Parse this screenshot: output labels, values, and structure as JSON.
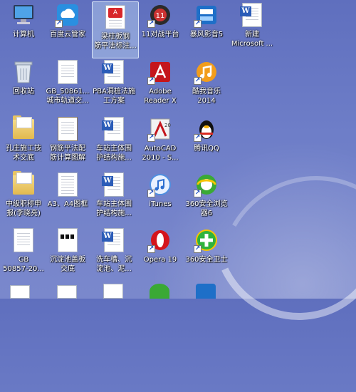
{
  "desktop": {
    "icons": [
      {
        "label": "计算机"
      },
      {
        "label": "百度云管家"
      },
      {
        "label": "梁柱板钢\n筋平法标注..."
      },
      {
        "label": "11对战平台"
      },
      {
        "label": "暴风影音5"
      },
      {
        "label": "新建\nMicrosoft ..."
      },
      {
        "label": "回收站"
      },
      {
        "label": "GB_50861...\n城市轨道交..."
      },
      {
        "label": "PBA洞桩法施\n工方案"
      },
      {
        "label": "Adobe\nReader X"
      },
      {
        "label": "酷我音乐\n2014"
      },
      {
        "label": "孔庄施工技\n术交底"
      },
      {
        "label": "钢筋平法配\n筋计算图解"
      },
      {
        "label": "车站主体围\n护结构施..."
      },
      {
        "label": "AutoCAD\n2010 - S..."
      },
      {
        "label": "腾讯QQ"
      },
      {
        "label": "中级职称申\n报(李晓亮)"
      },
      {
        "label": "A3、A4图框"
      },
      {
        "label": "车站主体围\n护结构施..."
      },
      {
        "label": "iTunes"
      },
      {
        "label": "360安全浏览\n器6"
      },
      {
        "label": "GB\n50857-20..."
      },
      {
        "label": "沉淀池盖板\n交底"
      },
      {
        "label": "洗车槽、沉\n淀池、泥..."
      },
      {
        "label": "Opera 19"
      },
      {
        "label": "360安全卫士"
      }
    ]
  }
}
